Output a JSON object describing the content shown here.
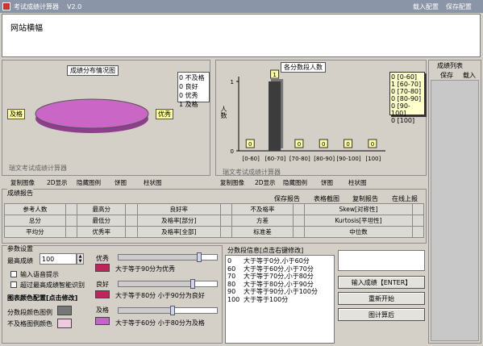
{
  "window": {
    "title": "考试成绩计算器",
    "version": "V2.0",
    "load_config": "载入配置",
    "save_config": "保存配置"
  },
  "banner": {
    "text": "网站横幅"
  },
  "pie": {
    "title": "成绩分布情况图",
    "left_label": "及格",
    "right_label": "优秀",
    "legend": [
      "0  不及格",
      "0  良好",
      "0  优秀",
      "1  及格"
    ],
    "footer": "瑞文考试成绩计算器"
  },
  "bar": {
    "title": "各分数段人数",
    "ylabel": "人数",
    "footer": "瑞文考试成绩计算器",
    "legend": [
      "0 [0-60]",
      "1 [60-70]",
      "0 [70-80]",
      "0 [80-90]",
      "0 [90-100]",
      "0 [100]"
    ],
    "chart_data": {
      "type": "bar",
      "categories": [
        "[0-60]",
        "[60-70]",
        "[70-80]",
        "[80-90]",
        "[90-100]",
        "[100]"
      ],
      "values": [
        0,
        1,
        0,
        0,
        0,
        0
      ],
      "ylim": [
        0,
        1
      ],
      "yticks": [
        "0",
        "1"
      ],
      "title": "各分数段人数",
      "ylabel": "人数",
      "legend_position": "right"
    }
  },
  "pie_toolbar": [
    "复制图像",
    "2D显示",
    "隐藏图例",
    "饼图",
    "柱状图"
  ],
  "bar_toolbar": [
    "复制图像",
    "2D显示",
    "隐藏图例",
    "饼图",
    "柱状图"
  ],
  "report": {
    "title": "成绩报告",
    "actions": [
      "保存报告",
      "表格截图",
      "复制报告",
      "在线上报"
    ],
    "rows": [
      [
        "参考人数",
        "",
        "最高分",
        "",
        "良好率",
        "",
        "不及格率",
        "",
        "Skew[对称性]",
        ""
      ],
      [
        "总分",
        "",
        "最低分",
        "",
        "及格率[部分]",
        "",
        "方差",
        "",
        "Kurtosis[平坦性]",
        ""
      ],
      [
        "平均分",
        "",
        "优秀率",
        "",
        "及格率[全部]",
        "",
        "标准差",
        "",
        "中位数",
        ""
      ]
    ]
  },
  "params": {
    "title": "参数设置",
    "max_label": "最高成绩",
    "max_value": "100",
    "voice": "输入语音提示",
    "smart": "超过最高成绩智能识别",
    "color_title": "图表颜色配置[点击修改]",
    "series_color": "分数段颜色图例",
    "fail_color": "不及格图例颜色",
    "grades": [
      {
        "name": "优秀",
        "desc": "大于等于90分为优秀",
        "color": "#c0245a",
        "level": 0.82
      },
      {
        "name": "良好",
        "desc": "大于等于80分 小于90分为良好",
        "color": "#c0245a",
        "level": 0.75
      },
      {
        "name": "及格",
        "desc": "大于等于60分 小于80分为及格",
        "color": "#c464c8",
        "level": 0.55
      }
    ]
  },
  "segments": {
    "title": "分数段信息[点击右键修改]",
    "rows": [
      [
        "0",
        "大于等于0分,小于60分"
      ],
      [
        "60",
        "大于等于60分,小于70分"
      ],
      [
        "70",
        "大于等于70分,小于80分"
      ],
      [
        "80",
        "大于等于80分,小于90分"
      ],
      [
        "90",
        "大于等于90分,小于100分"
      ],
      [
        "100",
        "大于等于100分"
      ]
    ]
  },
  "actions": {
    "input": "输入成绩【ENTER】",
    "restart": "重新开始",
    "limit": "图计算后"
  },
  "list": {
    "title": "成绩列表",
    "save": "保存",
    "load": "载入"
  },
  "colors": {
    "pie": "#c966c6",
    "bar": "#3c3c3c",
    "legend_bg": "#ffffcc"
  }
}
